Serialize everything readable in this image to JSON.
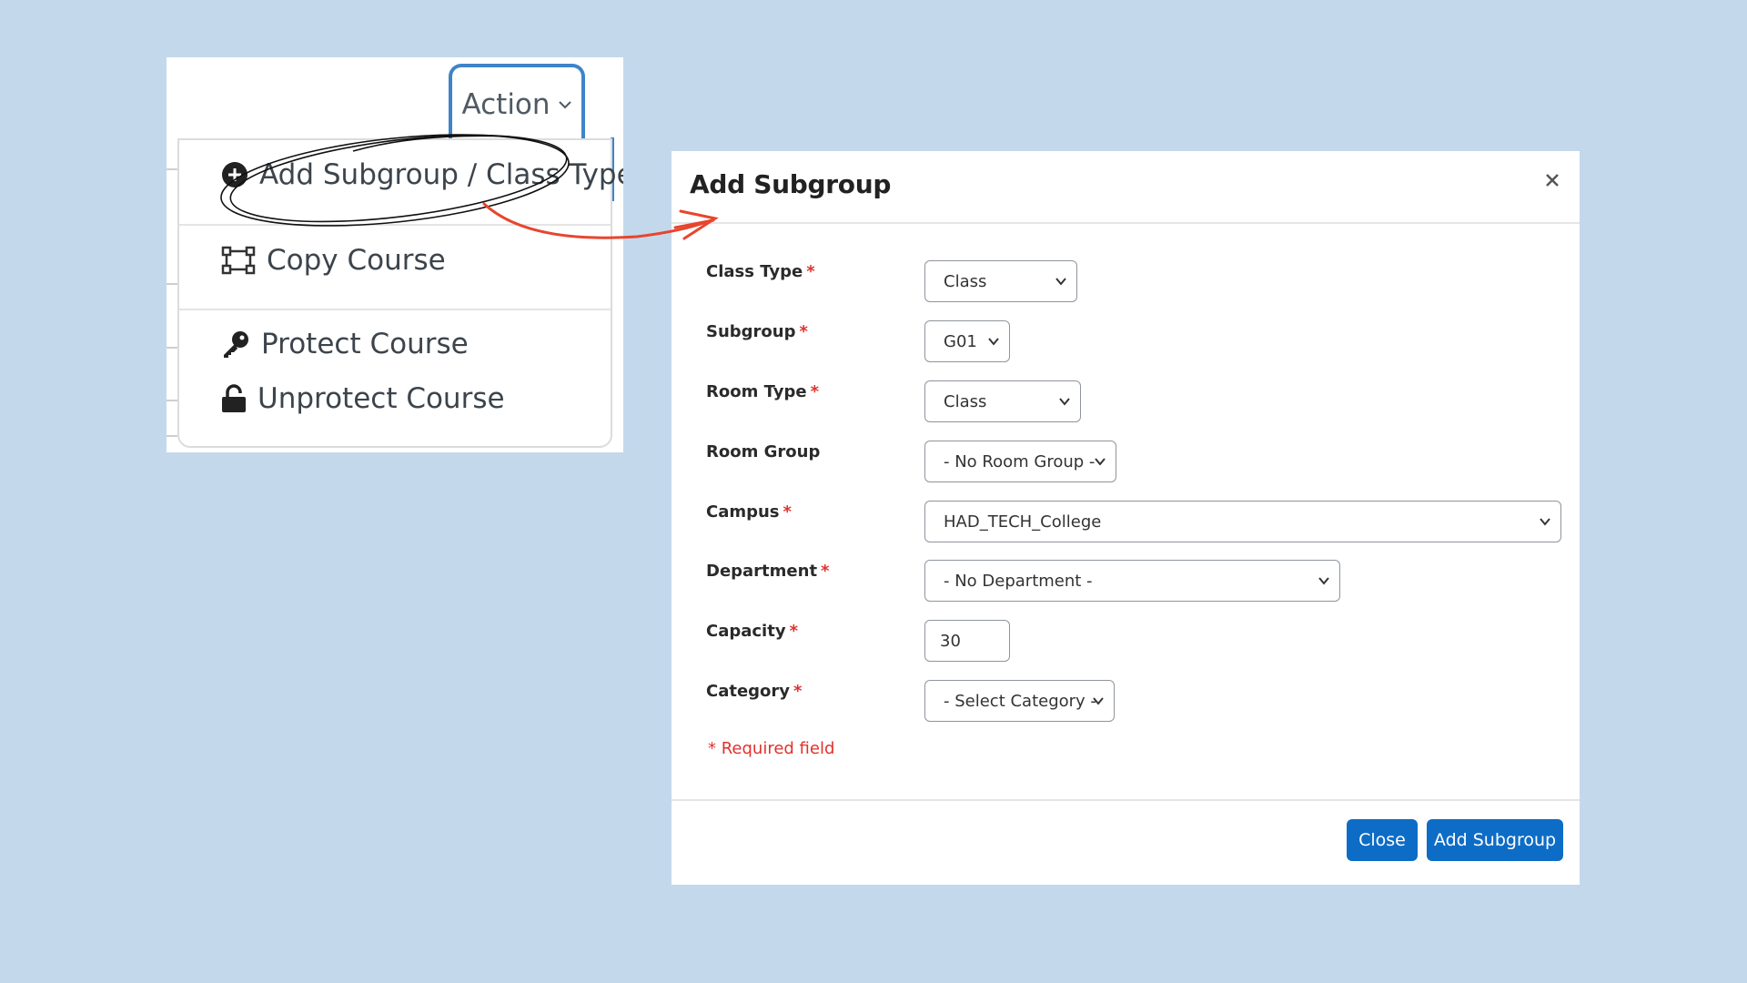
{
  "background_color": "#c4d8ec",
  "accent_color": "#0d6cc6",
  "action_panel": {
    "action_button": {
      "label": "Action",
      "icon": "chevron-down-icon"
    },
    "menu_items": [
      {
        "label": "Add Subgroup / Class Type",
        "icon": "plus-circle-icon"
      },
      {
        "label": "Copy Course",
        "icon": "copy-nodes-icon"
      },
      {
        "label": "Protect Course",
        "icon": "key-icon"
      },
      {
        "label": "Unprotect Course",
        "icon": "unlock-icon"
      }
    ]
  },
  "modal": {
    "title": "Add Subgroup",
    "close_icon": "close-icon",
    "fields": {
      "class_type": {
        "label": "Class Type",
        "required_mark": "*",
        "value": "Class"
      },
      "subgroup": {
        "label": "Subgroup",
        "required_mark": "*",
        "value": "G01"
      },
      "room_type": {
        "label": "Room Type",
        "required_mark": "*",
        "value": "Class"
      },
      "room_group": {
        "label": "Room Group",
        "value": "- No Room Group -"
      },
      "campus": {
        "label": "Campus",
        "required_mark": "*",
        "value": "HAD_TECH_College"
      },
      "department": {
        "label": "Department",
        "required_mark": "*",
        "value": "- No Department -"
      },
      "capacity": {
        "label": "Capacity",
        "required_mark": "*",
        "value": "30"
      },
      "category": {
        "label": "Category",
        "required_mark": "*",
        "value": "- Select Category -"
      }
    },
    "required_note": "* Required field",
    "buttons": {
      "close": "Close",
      "submit": "Add Subgroup"
    }
  }
}
